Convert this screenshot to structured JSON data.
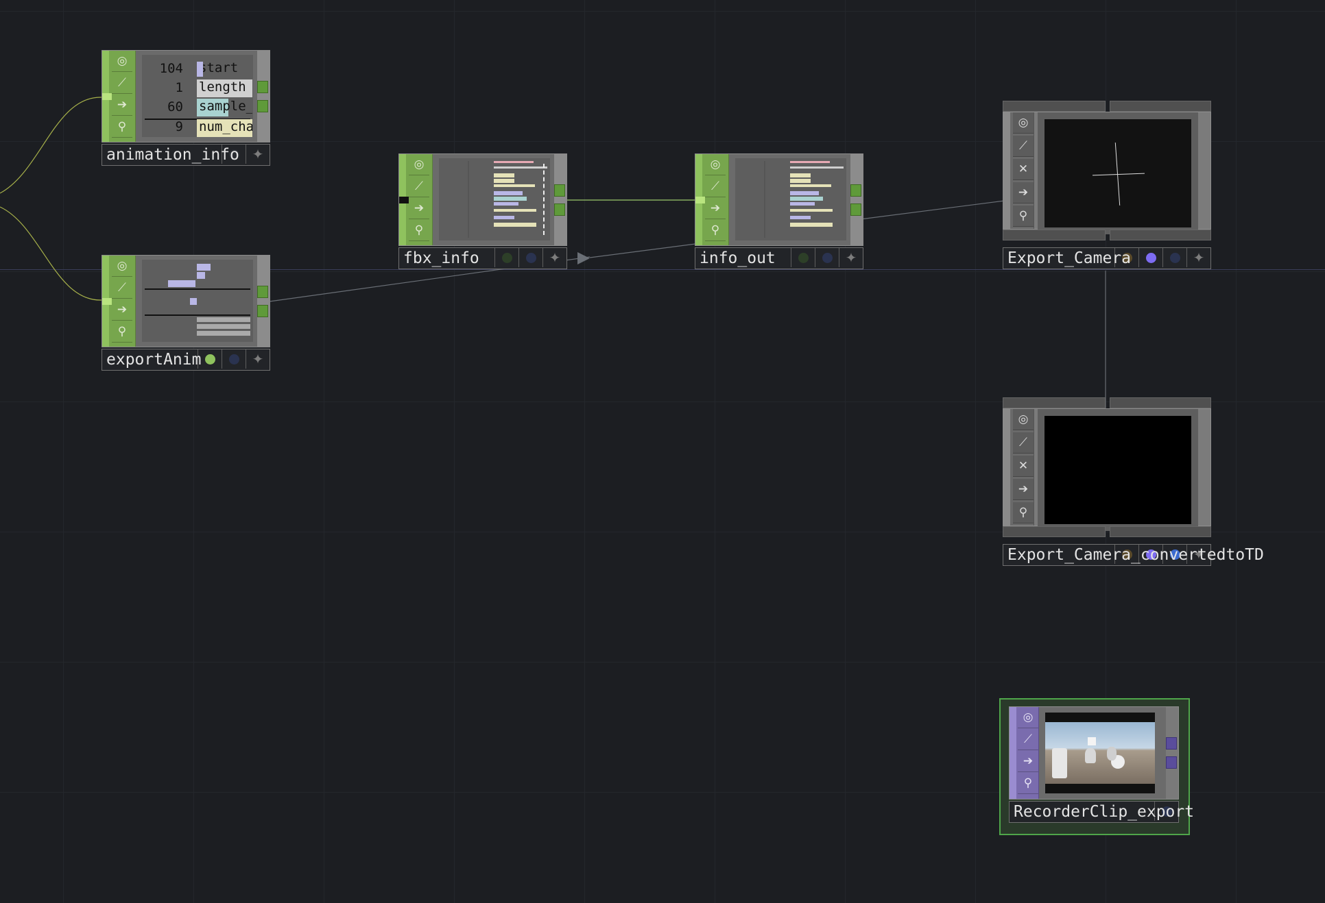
{
  "nodes": {
    "animation_info": {
      "name": "animation_info",
      "rows": [
        {
          "value": "104",
          "label": "start",
          "color": "#b9b7e6"
        },
        {
          "value": "1",
          "label": "length",
          "color": "#d9d9d9"
        },
        {
          "value": "60",
          "label": "sample_",
          "color": "#a9d2d0"
        },
        {
          "value": "9",
          "label": "num_cha",
          "color": "#e5e2b8"
        }
      ]
    },
    "exportAnim": {
      "name": "exportAnim"
    },
    "fbx_info": {
      "name": "fbx_info"
    },
    "info_out": {
      "name": "info_out"
    },
    "export_camera": {
      "name": "Export_Camera"
    },
    "export_camera_converted": {
      "name": "Export_Camera_convertedtoTD"
    },
    "recorder_clip": {
      "name": "RecorderClip_export"
    }
  },
  "flag_icons": [
    "viewer-flag-icon",
    "display-flag-icon",
    "bypass-flag-icon",
    "cook-flag-icon",
    "lock-flag-icon"
  ],
  "colors": {
    "background": "#1c1e22",
    "dat_green": "#77a64d",
    "comp_grey": "#6a6a6a",
    "top_purple": "#7a6cae",
    "selected_outline": "#4fa64a",
    "camera_dot": "#7d6cf2"
  }
}
